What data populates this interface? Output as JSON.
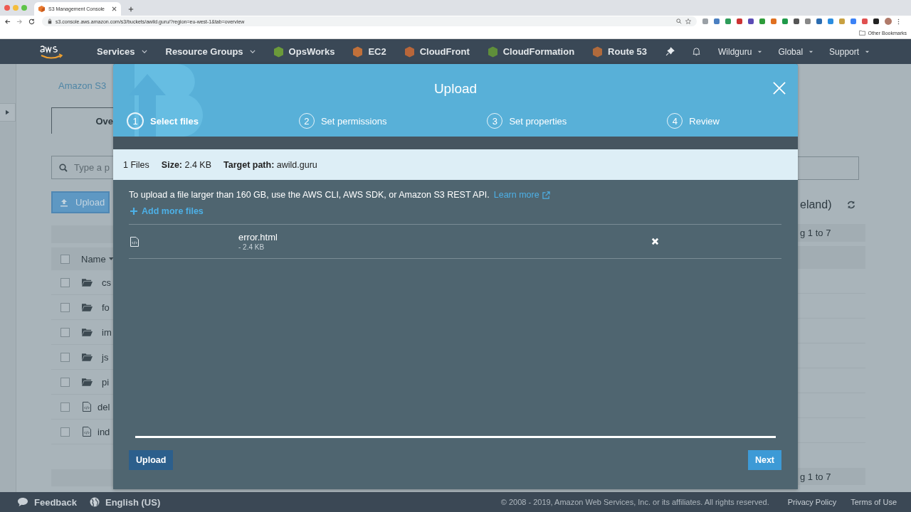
{
  "browser": {
    "tab_title": "S3 Management Console",
    "url": "s3.console.aws.amazon.com/s3/buckets/awild.guru/?region=eu-west-1&tab=overview",
    "bookmarks": "Other Bookmarks"
  },
  "nav": {
    "items": [
      {
        "label": "Services",
        "kind": "menu"
      },
      {
        "label": "Resource Groups",
        "kind": "menu"
      },
      {
        "label": "OpsWorks",
        "kind": "service",
        "color": "#6b9a3a"
      },
      {
        "label": "EC2",
        "kind": "service",
        "color": "#c0703a"
      },
      {
        "label": "CloudFront",
        "kind": "service",
        "color": "#b8663a"
      },
      {
        "label": "CloudFormation",
        "kind": "service",
        "color": "#5f8f3a"
      },
      {
        "label": "Route 53",
        "kind": "service",
        "color": "#b06a3c"
      }
    ],
    "account": [
      "Wildguru",
      "Global",
      "Support"
    ]
  },
  "page": {
    "breadcrumb": "Amazon S3",
    "tab": "Ove",
    "search_placeholder": "Type a p",
    "upload_button": "Upload",
    "column": "Name",
    "header_checked": false,
    "rows": [
      {
        "name": "cs",
        "kind": "folder",
        "checked": false
      },
      {
        "name": "fo",
        "kind": "folder",
        "checked": false
      },
      {
        "name": "im",
        "kind": "folder",
        "checked": false
      },
      {
        "name": "js",
        "kind": "folder",
        "checked": false
      },
      {
        "name": "pi",
        "kind": "folder",
        "checked": false
      },
      {
        "name": "del",
        "kind": "file",
        "checked": false
      },
      {
        "name": "ind",
        "kind": "file",
        "checked": false
      }
    ],
    "region": "eland)",
    "count_top": "g 1 to 7",
    "count_bottom": "g 1 to 7"
  },
  "modal": {
    "title": "Upload",
    "steps": [
      {
        "number": "1",
        "label": "Select files",
        "selected": true
      },
      {
        "number": "2",
        "label": "Set permissions",
        "selected": false
      },
      {
        "number": "3",
        "label": "Set properties",
        "selected": false
      },
      {
        "number": "4",
        "label": "Review",
        "selected": false
      }
    ],
    "summary": {
      "files": "1 Files",
      "size": "**Size:** 2.4 KB",
      "target": "**Target path:** awild.guru"
    },
    "notice": "To upload a file larger than 160 GB, use the AWS CLI, AWS SDK, or Amazon S3 REST API.",
    "learn_more": "Learn more",
    "add_files": "Add more files",
    "files": [
      {
        "name": "error.html",
        "size": "- 2.4 KB"
      }
    ],
    "buttons": [
      {
        "label": "Upload",
        "kind": "secondary"
      },
      {
        "label": "Next",
        "kind": "primary"
      }
    ]
  },
  "footer": {
    "feedback": "Feedback",
    "language": "English (US)",
    "copyright": "© 2008 - 2019, Amazon Web Services, Inc. or its affiliates. All rights reserved.",
    "links": [
      "Privacy Policy",
      "Terms of Use"
    ]
  }
}
